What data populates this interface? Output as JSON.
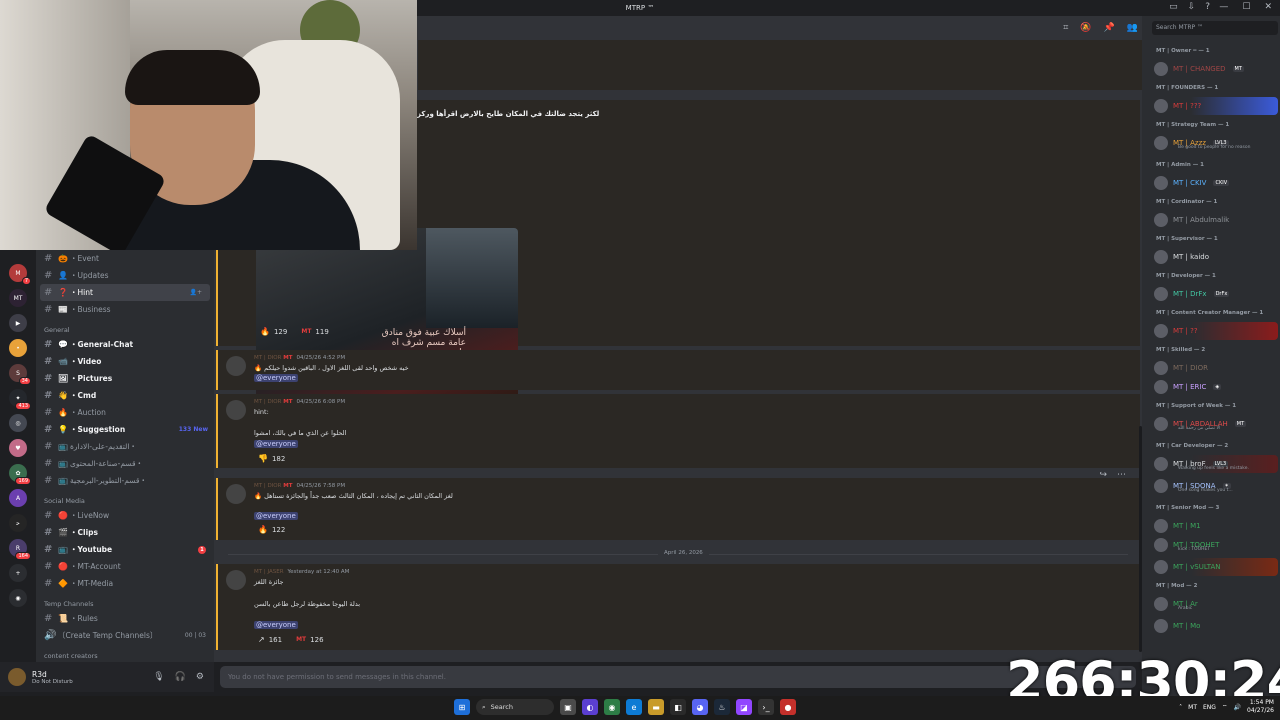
{
  "window": {
    "title": "MTRP ™",
    "controls": [
      "—",
      "☐",
      "✕"
    ]
  },
  "header": {
    "search_placeholder": "Search MTRP ™"
  },
  "rail": {
    "servers": [
      {
        "label": "M",
        "badge": "7",
        "color": "#b33b3b"
      },
      {
        "label": "MT",
        "badge": "",
        "color": "#2d2233"
      },
      {
        "label": "▶",
        "badge": "",
        "color": "#3e3e48"
      },
      {
        "label": "•",
        "badge": "",
        "color": "#e8a23a"
      },
      {
        "label": "S",
        "badge": "34",
        "color": "#5d3b3b"
      },
      {
        "label": "✦",
        "badge": "413",
        "color": "#24272c"
      },
      {
        "label": "◎",
        "badge": "",
        "color": "#444852"
      },
      {
        "label": "♥",
        "badge": "",
        "color": "#c26b88"
      },
      {
        "label": "✿",
        "badge": "169",
        "color": "#3a6d4e"
      },
      {
        "label": "A",
        "badge": "",
        "color": "#6b3faf"
      },
      {
        "label": "ﺣ",
        "badge": "",
        "color": "#252525"
      },
      {
        "label": "R",
        "badge": "164",
        "color": "#4a3d6b"
      },
      {
        "label": "+",
        "badge": "",
        "color": "#2b2d31"
      },
      {
        "label": "◉",
        "badge": "",
        "color": "#2b2d31"
      }
    ]
  },
  "sidebar": {
    "channels_top": [
      {
        "hash": "#",
        "emoji": "🎃",
        "name": "・Event",
        "style": ""
      },
      {
        "hash": "#",
        "emoji": "👤",
        "name": "・Updates",
        "style": ""
      },
      {
        "hash": "#",
        "emoji": "❓",
        "name": "・Hint",
        "style": "active",
        "right": "👤+"
      },
      {
        "hash": "#",
        "emoji": "📰",
        "name": "・Business",
        "style": ""
      }
    ],
    "cat_general": "General",
    "channels_general": [
      {
        "hash": "#",
        "emoji": "💬",
        "name": "・General-Chat",
        "style": "bold"
      },
      {
        "hash": "#",
        "emoji": "📹",
        "name": "・Video",
        "style": "bold"
      },
      {
        "hash": "#",
        "emoji": "🖼",
        "name": "・Pictures",
        "style": "bold"
      },
      {
        "hash": "#",
        "emoji": "👋",
        "name": "・Cmd",
        "style": "bold"
      },
      {
        "hash": "#",
        "emoji": "🔥",
        "name": "・Auction",
        "style": ""
      },
      {
        "hash": "#",
        "emoji": "💡",
        "name": "・Suggestion",
        "style": "bold",
        "new": "133 New"
      },
      {
        "hash": "#",
        "emoji": "📺",
        "name": "التقديم-على-الادارة・",
        "style": ""
      },
      {
        "hash": "#",
        "emoji": "📺",
        "name": "قسم-صناعة-المحتوى・",
        "style": ""
      },
      {
        "hash": "#",
        "emoji": "📺",
        "name": "قسم-التطوير-البرمجية・",
        "style": ""
      }
    ],
    "cat_social": "Social Media",
    "channels_social": [
      {
        "hash": "#",
        "emoji": "🔴",
        "name": "・LiveNow",
        "style": ""
      },
      {
        "hash": "#",
        "emoji": "🎬",
        "name": "・Clips",
        "style": "bold"
      },
      {
        "hash": "#",
        "emoji": "📺",
        "name": "・Youtube",
        "style": "bold",
        "dot": "1"
      },
      {
        "hash": "#",
        "emoji": "🔴",
        "name": "・MT-Account",
        "style": ""
      },
      {
        "hash": "#",
        "emoji": "🔶",
        "name": "・MT-Media",
        "style": ""
      }
    ],
    "cat_temp": "Temp Channels",
    "channels_temp": [
      {
        "hash": "#",
        "emoji": "📜",
        "name": "・Rules",
        "style": ""
      },
      {
        "hash": "🔊",
        "emoji": "",
        "name": "〔Create Temp Channels〕",
        "style": "",
        "right": "00 | 03"
      }
    ],
    "cat_creators": "content creators"
  },
  "user": {
    "name": "R3d",
    "status": "Do Not Disturb"
  },
  "post": {
    "title": "لكثر يتجد ضالتك في المكان طايح بالارض اقرأها وركز",
    "image_text": "أسلاك عبية فوق منادق عامة مسم شرف اه طيح",
    "reactions": [
      {
        "emoji": "🔥",
        "count": "129"
      },
      {
        "emoji": "MT",
        "count": "119"
      }
    ]
  },
  "messages": [
    {
      "author": "MT | DIOR",
      "tag": "MT",
      "time": "04/25/26 4:52 PM",
      "lines": [
        "🔥 خيه شخص واحد لقى اللغز الاول ، الباقين شدوا حيلكم"
      ],
      "mention": "@everyone",
      "reactions": []
    },
    {
      "author": "MT | DIOR",
      "tag": "MT",
      "time": "04/25/26 6:08 PM",
      "lines": [
        "hint:",
        "الحلوا عن الذي ما في بالك، امشوا"
      ],
      "mention": "@everyone",
      "reactions": [
        {
          "emoji": "👎",
          "count": "182"
        }
      ]
    },
    {
      "author": "MT | DIOR",
      "tag": "MT",
      "time": "04/25/26 7:58 PM",
      "lines": [
        "🔥 لغز المكان الثاني تم إيجاده ، المكان الثالث صعب جداً والجائزة تستاهل"
      ],
      "mention": "@everyone",
      "reactions": [
        {
          "emoji": "🔥",
          "count": "122"
        }
      ]
    },
    {
      "author": "MT | JASER",
      "tag": "",
      "time": "Yesterday at 12:40 AM",
      "lines": [
        "جائزة اللغز",
        "بدلة اليوجا مخفوظة لرجل طاعن بالسن"
      ],
      "mention": "@everyone",
      "reactions": [
        {
          "emoji": "↗",
          "count": "161"
        },
        {
          "emoji": "MT",
          "count": "126"
        }
      ]
    }
  ],
  "date_divider": "April 26, 2026",
  "composer": {
    "placeholder": "You do not have permission to send messages in this channel."
  },
  "members": [
    {
      "type": "role",
      "text": "MT | Owner ━ — 1"
    },
    {
      "type": "member",
      "name": "MT | CHANGED",
      "color": "#a04646",
      "badge": "MT"
    },
    {
      "type": "role",
      "text": "MT | FOUNDERS — 1"
    },
    {
      "type": "member",
      "name": "MT | ???",
      "color": "#d83c3c",
      "badge": "",
      "bg": "#3b5bdb"
    },
    {
      "type": "role",
      "text": "MT | Strategy Team — 1"
    },
    {
      "type": "member",
      "name": "MT | Azzz",
      "color": "#e8a23a",
      "badge": "LVL3",
      "sub": "Be good to people for no reason"
    },
    {
      "type": "role",
      "text": "MT | Admin — 1"
    },
    {
      "type": "member",
      "name": "MT | CKIV",
      "color": "#5cb3ff",
      "badge": "CKIV"
    },
    {
      "type": "role",
      "text": "MT | Cordinator — 1"
    },
    {
      "type": "member",
      "name": "MT | Abdulmalik",
      "color": "#8e9297",
      "badge": ""
    },
    {
      "type": "role",
      "text": "MT | Supervisor — 1"
    },
    {
      "type": "member",
      "name": "MT | kaido",
      "color": "#dbdee1",
      "badge": ""
    },
    {
      "type": "role",
      "text": "MT | Developer — 1"
    },
    {
      "type": "member",
      "name": "MT | DrFx",
      "color": "#43c8a4",
      "badge": "DrFx"
    },
    {
      "type": "role",
      "text": "MT | Content Creator Manager — 1"
    },
    {
      "type": "member",
      "name": "MT | ??",
      "color": "#d83c3c",
      "badge": "",
      "bg": "#8b1c1c"
    },
    {
      "type": "role",
      "text": "MT | Skilled — 2"
    },
    {
      "type": "member",
      "name": "MT | DIOR",
      "color": "#7d6a5d",
      "badge": ""
    },
    {
      "type": "member",
      "name": "MT | ERIC",
      "color": "#c9a0ff",
      "badge": "◈"
    },
    {
      "type": "role",
      "text": "MT | Support of Week — 1"
    },
    {
      "type": "member",
      "name": "MT | ABDALLAH",
      "color": "#e04b4b",
      "badge": "MT",
      "sub": "الا تصلي من رحمة الله"
    },
    {
      "type": "role",
      "text": "MT | Car Developer — 2"
    },
    {
      "type": "member",
      "name": "MT | broF",
      "color": "#dbdee1",
      "badge": "LVL3",
      "sub": "Walking up feels like a mistake.",
      "bg": "#5a1f1f"
    },
    {
      "type": "member",
      "name": "MT | SDONA",
      "color": "#a7c4ff",
      "badge": "✶",
      "sub": "One song makes you t..."
    },
    {
      "type": "role",
      "text": "MT | Senior Mod — 3"
    },
    {
      "type": "member",
      "name": "MT | M1",
      "color": "#3ba55c",
      "badge": ""
    },
    {
      "type": "member",
      "name": "MT | TOOHET",
      "color": "#3ba55c",
      "badge": "",
      "sub": "kick : TOOHET"
    },
    {
      "type": "member",
      "name": "MT | vSULTAN",
      "color": "#3ba55c",
      "badge": "",
      "bg": "#7a2a14"
    },
    {
      "type": "role",
      "text": "MT | Mod — 2"
    },
    {
      "type": "member",
      "name": "MT | Ar",
      "color": "#3ba55c",
      "badge": "",
      "sub": "Arabic"
    },
    {
      "type": "member",
      "name": "MT | Mo",
      "color": "#3ba55c",
      "badge": ""
    }
  ],
  "timer": "266:30:24",
  "taskbar": {
    "search": "Search",
    "lang": "ENG",
    "time": "1:54 PM",
    "date": "04/27/26"
  }
}
